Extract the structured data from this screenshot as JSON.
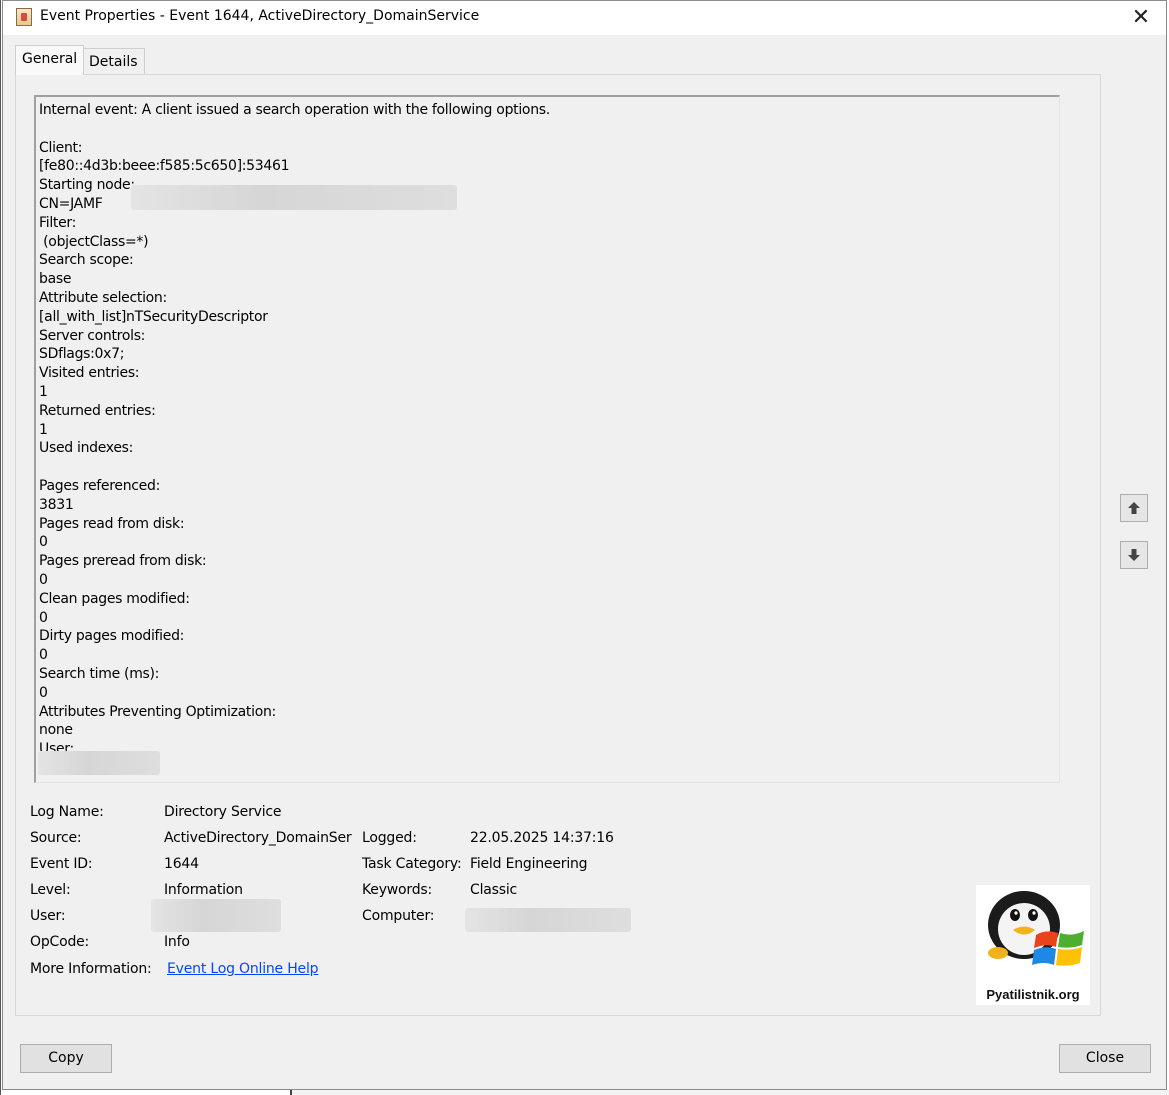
{
  "window": {
    "title": "Event Properties - Event 1644, ActiveDirectory_DomainService",
    "close_glyph": "✕"
  },
  "tabs": [
    {
      "label": "General",
      "selected": true
    },
    {
      "label": "Details",
      "selected": false
    }
  ],
  "description_lines": [
    "Internal event: A client issued a search operation with the following options.",
    "",
    "Client:",
    "[fe80::4d3b:beee:f585:5c650]:53461",
    "Starting node:",
    "CN=JAMF",
    "Filter:",
    " (objectClass=*)",
    "Search scope:",
    "base",
    "Attribute selection:",
    "[all_with_list]nTSecurityDescriptor",
    "Server controls:",
    "SDflags:0x7;",
    "Visited entries:",
    "1",
    "Returned entries:",
    "1",
    "Used indexes:",
    "",
    "Pages referenced:",
    "3831",
    "Pages read from disk:",
    "0",
    "Pages preread from disk:",
    "0",
    "Clean pages modified:",
    "0",
    "Dirty pages modified:",
    "0",
    "Search time (ms):",
    "0",
    "Attributes Preventing Optimization:",
    "none",
    "User:",
    ""
  ],
  "fields": {
    "log_name": {
      "label": "Log Name:",
      "value": "Directory Service"
    },
    "source": {
      "label": "Source:",
      "value": "ActiveDirectory_DomainServ"
    },
    "logged": {
      "label": "Logged:",
      "value": "22.05.2025 14:37:16"
    },
    "event_id": {
      "label": "Event ID:",
      "value": "1644"
    },
    "task_category": {
      "label": "Task Category:",
      "value": "Field Engineering"
    },
    "level": {
      "label": "Level:",
      "value": "Information"
    },
    "keywords": {
      "label": "Keywords:",
      "value": "Classic"
    },
    "user": {
      "label": "User:",
      "value": ""
    },
    "computer": {
      "label": "Computer:",
      "value": ""
    },
    "opcode": {
      "label": "OpCode:",
      "value": "Info"
    },
    "more_info": {
      "label": "More Information:",
      "link": "Event Log Online Help"
    }
  },
  "nav": {
    "up_icon": "arrow-up-icon",
    "down_icon": "arrow-down-icon"
  },
  "logo": {
    "text": "Pyatilistnik.org"
  },
  "buttons": {
    "copy": "Copy",
    "close": "Close"
  }
}
